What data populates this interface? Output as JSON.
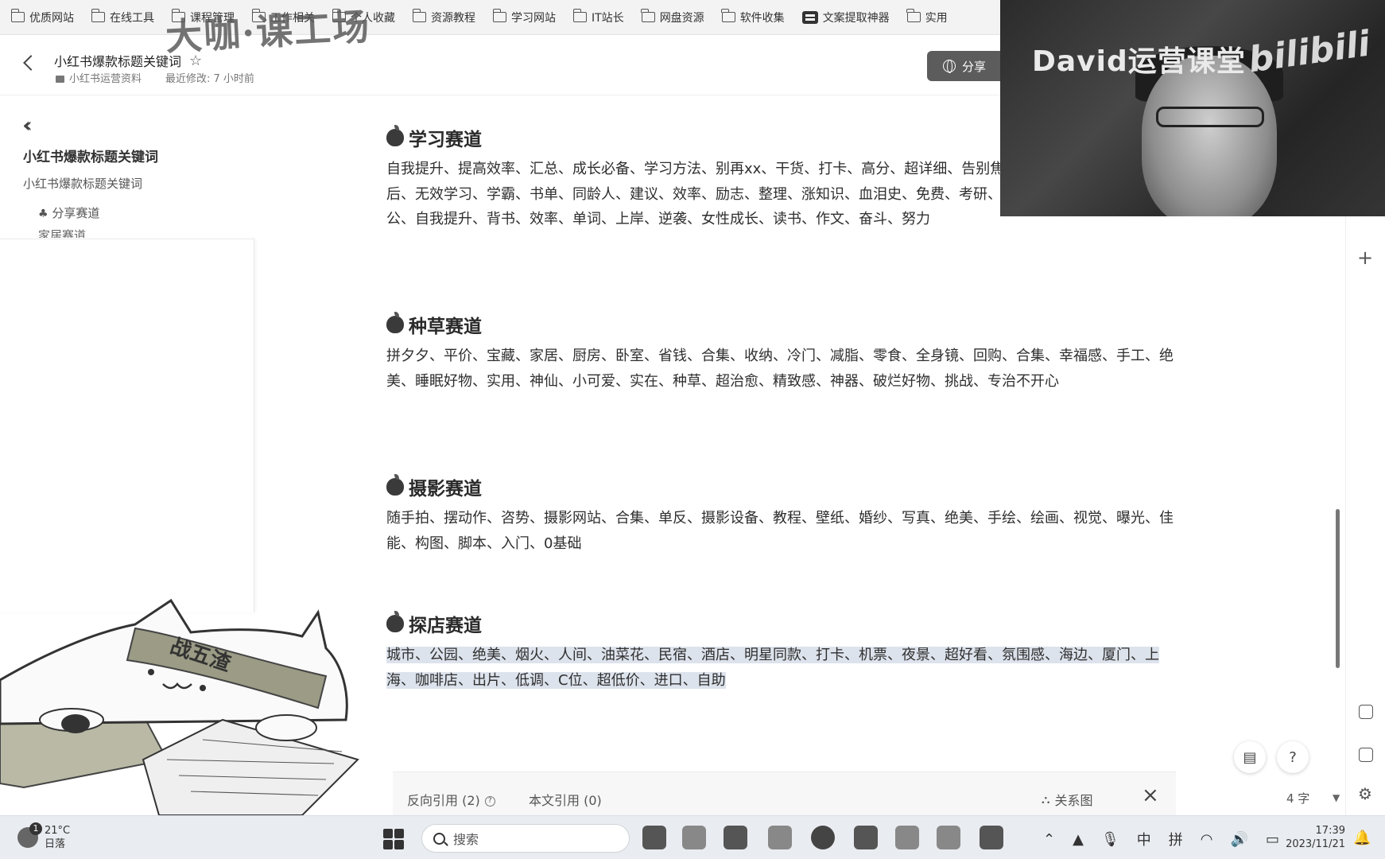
{
  "bookmarks": [
    {
      "label": "优质网站",
      "icon": "folder-icon"
    },
    {
      "label": "在线工具",
      "icon": "folder-icon"
    },
    {
      "label": "课程管理",
      "icon": "folder-icon"
    },
    {
      "label": "工作相关",
      "icon": "folder-icon"
    },
    {
      "label": "个人收藏",
      "icon": "folder-icon"
    },
    {
      "label": "资源教程",
      "icon": "folder-icon"
    },
    {
      "label": "学习网站",
      "icon": "folder-icon"
    },
    {
      "label": "IT站长",
      "icon": "folder-icon"
    },
    {
      "label": "网盘资源",
      "icon": "folder-icon"
    },
    {
      "label": "软件收集",
      "icon": "folder-icon"
    },
    {
      "label": "文案提取神器",
      "icon": "app-icon"
    },
    {
      "label": "实用",
      "icon": "folder-icon"
    }
  ],
  "watermark_top": "大咖·课工场",
  "header": {
    "title": "小红书爆款标题关键词",
    "folder": "小红书运营资料",
    "modified": "最近修改: 7 小时前",
    "share_label": "分享"
  },
  "sidebar": {
    "title": "小红书爆款标题关键词",
    "doc": "小红书爆款标题关键词",
    "item1": "分享赛道",
    "item2": "家居赛道"
  },
  "sections": [
    {
      "title": "学习赛道",
      "body": "自我提升、提高效率、汇总、成长必备、学习方法、别再xx、干货、打卡、高分、超详细、告别焦虑、逆袭、假努力、下班后、无效学习、学霸、书单、同龄人、建议、效率、励志、整理、涨知识、血泪史、免费、考研、四六级、专四、教育学、考公、自我提升、背书、效率、单词、上岸、逆袭、女性成长、读书、作文、奋斗、努力"
    },
    {
      "title": "种草赛道",
      "body": "拼夕夕、平价、宝藏、家居、厨房、卧室、省钱、合集、收纳、冷门、减脂、零食、全身镜、回购、合集、幸福感、手工、绝美、睡眠好物、实用、神仙、小可爱、实在、种草、超治愈、精致感、神器、破烂好物、挑战、专治不开心"
    },
    {
      "title": "摄影赛道",
      "body": "随手拍、摆动作、咨势、摄影网站、合集、单反、摄影设备、教程、壁纸、婚纱、写真、绝美、手绘、绘画、视觉、曝光、佳能、构图、脚本、入门、0基础"
    },
    {
      "title": "探店赛道",
      "body": "城市、公园、绝美、烟火、人间、油菜花、民宿、酒店、明星同款、打卡、机票、夜景、超好看、氛围感、海边、厦门、上海、咖啡店、出片、低调、C位、超低价、进口、自助"
    }
  ],
  "refbar": {
    "backlinks": "反向引用 (2)",
    "citations": "本文引用 (0)",
    "graph": "关系图"
  },
  "word_count": "4 字",
  "webcam": {
    "label": "David运营课堂",
    "logo": "bilibili"
  },
  "cat_sticker_text": "战五渣",
  "taskbar": {
    "temp": "21°C",
    "weather": "日落",
    "search_placeholder": "搜索",
    "ime1": "中",
    "ime2": "拼",
    "time": "17:39",
    "date": "2023/11/21"
  }
}
